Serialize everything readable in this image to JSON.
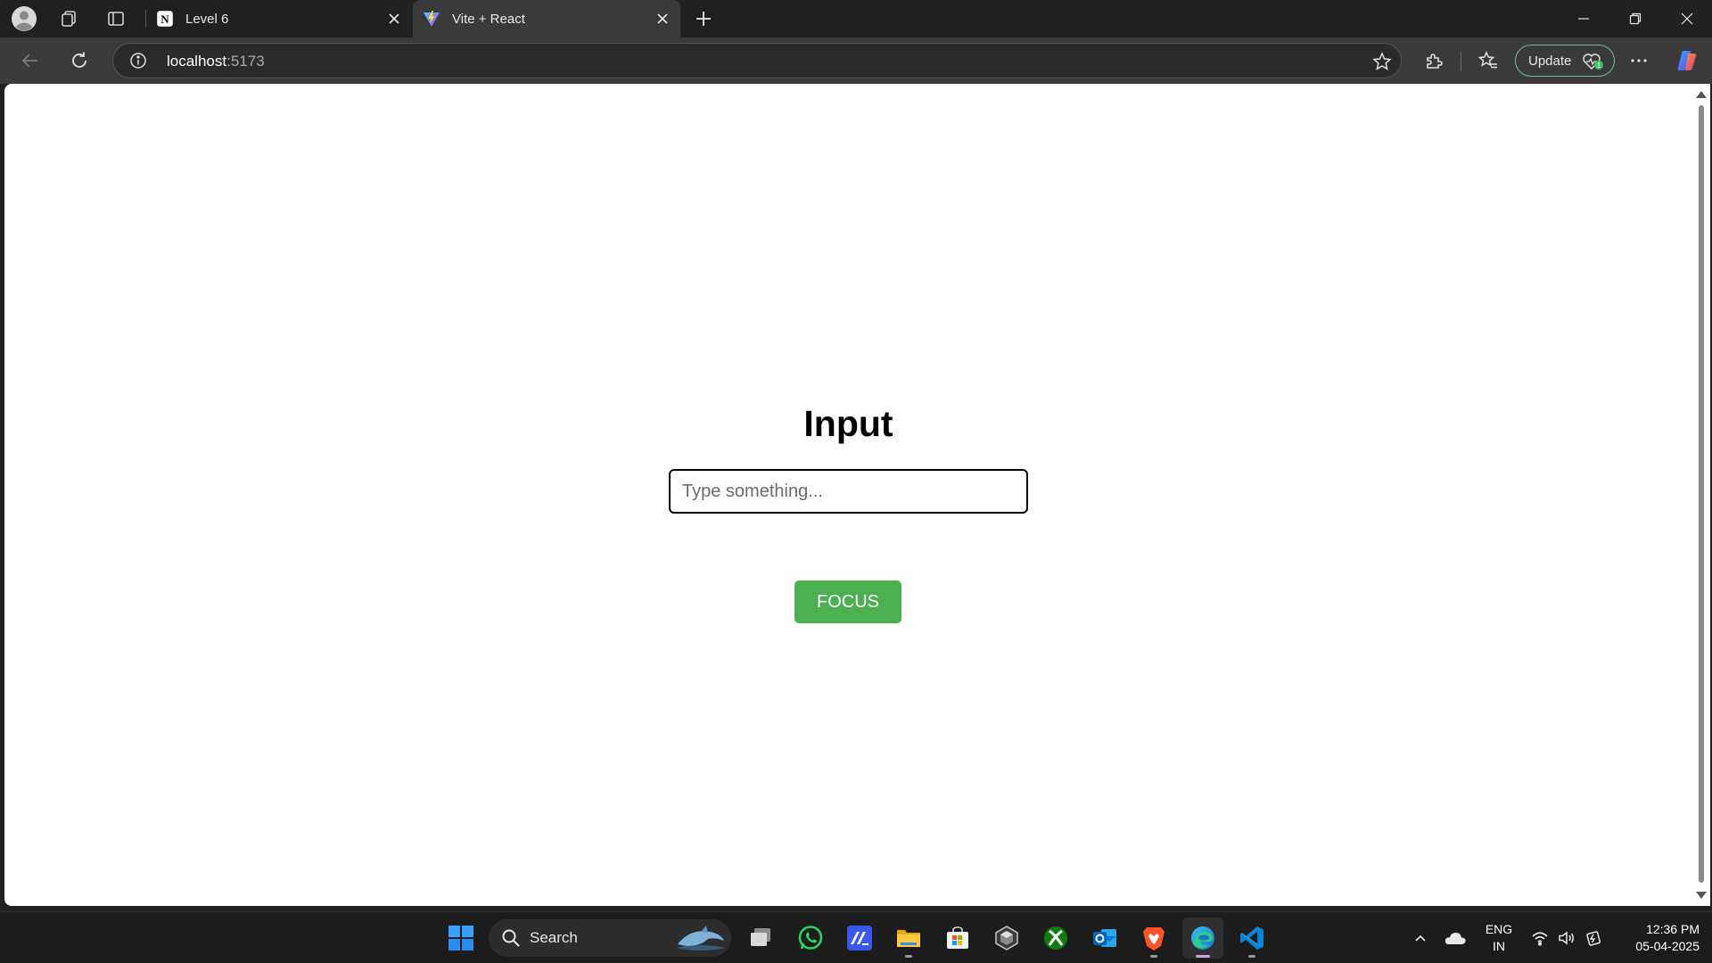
{
  "browser": {
    "tabs": [
      {
        "title": "Level 6",
        "active": false,
        "favicon": "notion-icon"
      },
      {
        "title": "Vite + React",
        "active": true,
        "favicon": "vite-icon"
      }
    ],
    "address": {
      "host": "localhost",
      "port": ":5173"
    },
    "update_label": "Update"
  },
  "page": {
    "heading": "Input",
    "input_placeholder": "Type something...",
    "input_value": "",
    "button_label": "FOCUS",
    "button_color": "#4caf50"
  },
  "taskbar": {
    "search_label": "Search",
    "language": {
      "line1": "ENG",
      "line2": "IN"
    },
    "time": "12:36 PM",
    "date": "05-04-2025",
    "pinned_apps": [
      "windows-start",
      "search",
      "task-view",
      "whatsapp",
      "app-blue",
      "file-explorer",
      "microsoft-store",
      "unity",
      "xbox",
      "outlook",
      "brave",
      "edge",
      "vscode"
    ]
  },
  "colors": {
    "accent_green": "#4caf50",
    "update_border": "#6cc08a",
    "edge_running": "#d49ee6"
  }
}
